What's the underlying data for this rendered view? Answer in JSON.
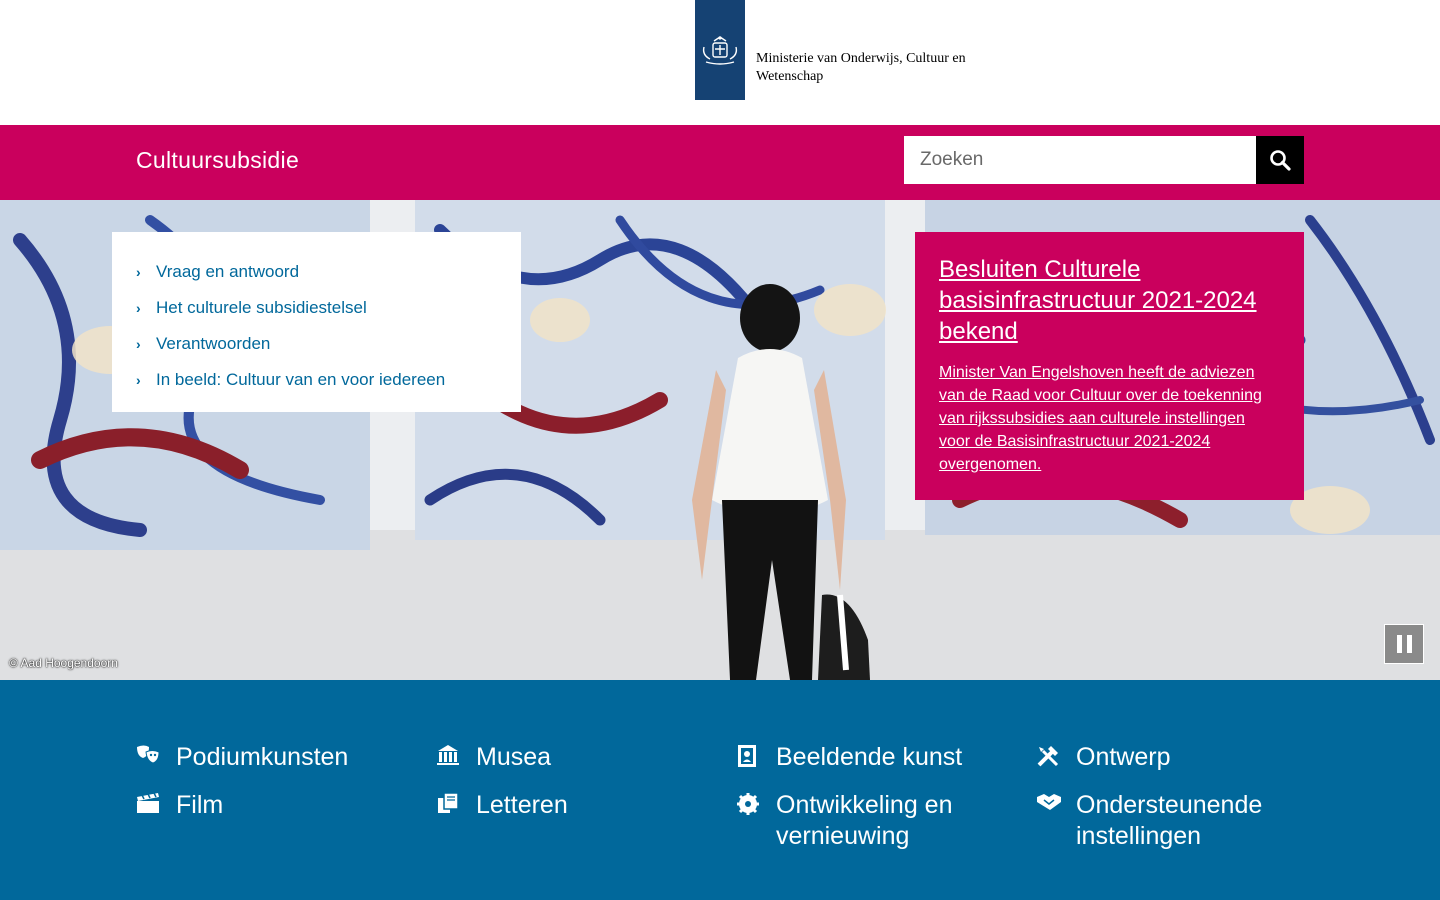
{
  "header": {
    "ministry_name": "Ministerie van Onderwijs, Cultuur en Wetenschap"
  },
  "topbar": {
    "site_title": "Cultuursubsidie",
    "search_placeholder": "Zoeken",
    "colors": {
      "bar": "#ca005d",
      "search_button": "#000000"
    }
  },
  "nav": {
    "items": [
      {
        "label": "Vraag en antwoord"
      },
      {
        "label": "Het culturele subsidiestelsel"
      },
      {
        "label": "Verantwoorden"
      },
      {
        "label": "In beeld: Cultuur van en voor iedereen"
      }
    ]
  },
  "feature": {
    "title": "Besluiten Culturele basisinfrastructuur 2021-2024 bekend",
    "body": "Minister Van Engelshoven heeft de adviezen van de Raad voor Cultuur over de toekenning van rijkssubsidies aan culturele instellingen voor de Basisinfrastructuur 2021-2024 overgenomen."
  },
  "hero": {
    "photo_credit": "© Aad Hoogendoorn",
    "pause_icon": "pause-icon"
  },
  "categories": [
    {
      "label": "Podiumkunsten",
      "icon": "theater-masks-icon"
    },
    {
      "label": "Musea",
      "icon": "museum-icon"
    },
    {
      "label": "Beeldende kunst",
      "icon": "art-frame-icon"
    },
    {
      "label": "Ontwerp",
      "icon": "design-tools-icon"
    },
    {
      "label": "Film",
      "icon": "film-clapper-icon"
    },
    {
      "label": "Letteren",
      "icon": "books-icon"
    },
    {
      "label": "Ontwikkeling en vernieuwing",
      "icon": "innovation-icon"
    },
    {
      "label": "Ondersteunende instellingen",
      "icon": "handshake-icon"
    }
  ],
  "colors": {
    "brand_pink": "#ca005d",
    "brand_blue": "#01689b",
    "logo_blue": "#154273"
  }
}
